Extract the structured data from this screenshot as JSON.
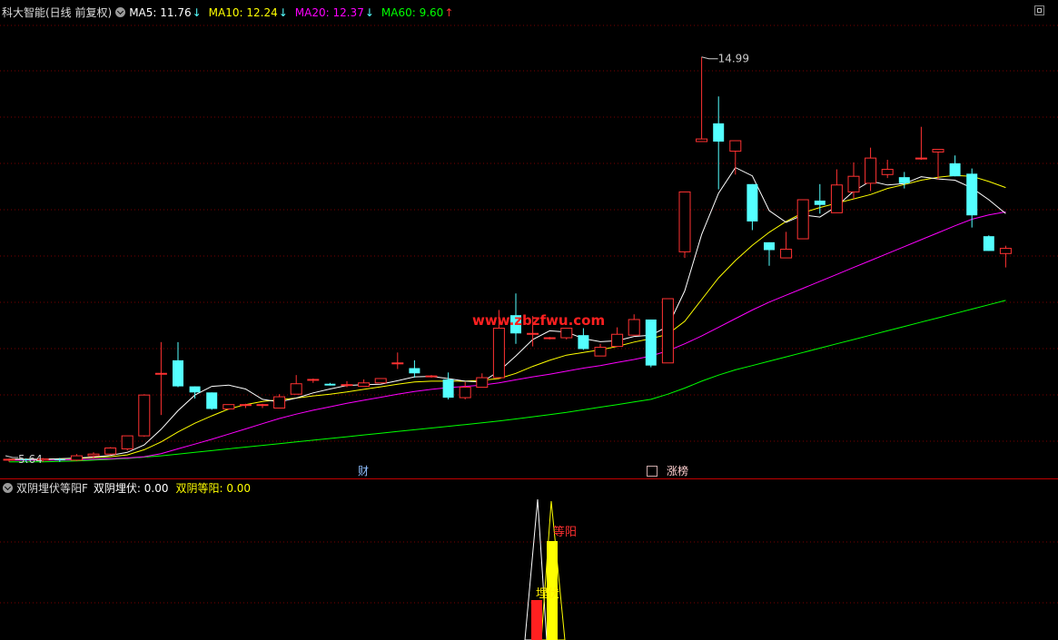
{
  "main_header": {
    "title": "科大智能(日线 前复权)",
    "ma5": {
      "label": "MA5: 11.76",
      "arrow": "↓",
      "color": "#ffffff"
    },
    "ma10": {
      "label": "MA10: 12.24",
      "arrow": "↓",
      "color": "#ffff00"
    },
    "ma20": {
      "label": "MA20: 12.37",
      "arrow": "↓",
      "color": "#ff00ff"
    },
    "ma60": {
      "label": "MA60: 9.60",
      "arrow": "↑",
      "color": "#00ff00"
    }
  },
  "chart_labels": {
    "high_price": "14.99",
    "low_price": "5.64",
    "watermark": "www.zbzfwu.com",
    "badge_finance": "财",
    "badge_limit": "涨榜"
  },
  "sub_header": {
    "indicator_name": "双阴埋伏等阳F",
    "line1": {
      "label": "双阴埋伏: 0.00",
      "color": "#ffffff"
    },
    "line2": {
      "label": "双阴等阳: 0.00",
      "color": "#ffff00"
    }
  },
  "sub_labels": {
    "deng_yang": "等阳",
    "mai_fu": "埋伏"
  },
  "colors": {
    "up": "#ff3232",
    "down": "#54ffff",
    "grid": "#7a0000",
    "divider": "#c00000"
  },
  "chart_data": {
    "type": "candlestick",
    "series": [
      {
        "name": "MA5",
        "color": "#ffffff"
      },
      {
        "name": "MA10",
        "color": "#ffff00"
      },
      {
        "name": "MA20",
        "color": "#ff00ff"
      },
      {
        "name": "MA60",
        "color": "#00ff00"
      }
    ],
    "candles": [
      [
        5.7,
        5.72,
        5.66,
        5.74
      ],
      [
        5.72,
        5.7,
        5.66,
        5.74
      ],
      [
        5.7,
        5.73,
        5.66,
        5.75
      ],
      [
        5.72,
        5.71,
        5.66,
        5.75
      ],
      [
        5.7,
        5.8,
        5.68,
        5.84
      ],
      [
        5.8,
        5.84,
        5.74,
        5.88
      ],
      [
        5.84,
        5.98,
        5.82,
        6.0
      ],
      [
        5.96,
        6.26,
        5.92,
        6.26
      ],
      [
        6.26,
        7.2,
        6.24,
        7.22
      ],
      [
        7.7,
        7.7,
        6.74,
        8.42
      ],
      [
        8.0,
        7.4,
        7.38,
        8.42
      ],
      [
        7.4,
        7.26,
        7.12,
        7.4
      ],
      [
        7.26,
        6.88,
        6.86,
        7.26
      ],
      [
        6.88,
        6.98,
        6.86,
        6.98
      ],
      [
        6.98,
        6.98,
        6.9,
        7.0
      ],
      [
        6.98,
        6.98,
        6.9,
        7.0
      ],
      [
        6.9,
        7.16,
        6.9,
        7.22
      ],
      [
        7.22,
        7.46,
        7.22,
        7.66
      ],
      [
        7.56,
        7.56,
        7.48,
        7.58
      ],
      [
        7.46,
        7.42,
        7.42,
        7.48
      ],
      [
        7.42,
        7.44,
        7.38,
        7.52
      ],
      [
        7.4,
        7.48,
        7.4,
        7.56
      ],
      [
        7.48,
        7.58,
        7.48,
        7.58
      ],
      [
        7.94,
        7.94,
        7.8,
        8.18
      ],
      [
        7.82,
        7.7,
        7.6,
        8.0
      ],
      [
        7.64,
        7.64,
        7.6,
        7.66
      ],
      [
        7.56,
        7.14,
        7.1,
        7.72
      ],
      [
        7.14,
        7.38,
        7.1,
        7.5
      ],
      [
        7.38,
        7.6,
        7.38,
        7.7
      ],
      [
        7.6,
        8.74,
        7.6,
        9.16
      ],
      [
        9.04,
        8.62,
        8.38,
        9.54
      ],
      [
        8.62,
        8.62,
        8.32,
        9.02
      ],
      [
        8.52,
        8.52,
        8.48,
        8.54
      ],
      [
        8.52,
        8.74,
        8.48,
        8.74
      ],
      [
        8.58,
        8.26,
        8.24,
        8.74
      ],
      [
        8.1,
        8.3,
        8.1,
        8.38
      ],
      [
        8.32,
        8.6,
        8.32,
        8.76
      ],
      [
        8.58,
        8.94,
        8.58,
        9.06
      ],
      [
        8.94,
        7.88,
        7.84,
        8.94
      ],
      [
        7.94,
        9.42,
        7.94,
        9.42
      ],
      [
        10.5,
        11.88,
        10.36,
        11.88
      ],
      [
        13.04,
        13.1,
        13.04,
        14.99
      ],
      [
        13.46,
        13.04,
        11.94,
        14.08
      ],
      [
        12.82,
        13.06,
        12.28,
        12.82
      ],
      [
        12.06,
        11.2,
        11.0,
        12.06
      ],
      [
        10.72,
        10.54,
        10.18,
        10.72
      ],
      [
        10.36,
        10.56,
        10.48,
        10.96
      ],
      [
        10.8,
        11.7,
        10.8,
        11.7
      ],
      [
        11.68,
        11.58,
        11.38,
        12.06
      ],
      [
        11.4,
        12.04,
        11.46,
        12.4
      ],
      [
        11.88,
        12.24,
        11.72,
        12.56
      ],
      [
        12.08,
        12.66,
        11.9,
        12.9
      ],
      [
        12.28,
        12.4,
        12.2,
        12.62
      ],
      [
        12.22,
        12.08,
        11.96,
        12.34
      ],
      [
        12.66,
        12.66,
        12.62,
        13.38
      ],
      [
        12.8,
        12.86,
        12.16,
        12.86
      ],
      [
        12.54,
        12.24,
        12.24,
        12.72
      ],
      [
        12.3,
        11.34,
        11.06,
        12.42
      ],
      [
        10.86,
        10.52,
        10.52,
        10.88
      ],
      [
        10.46,
        10.58,
        10.14,
        10.64
      ]
    ],
    "ma5": [
      5.72,
      5.72,
      5.72,
      5.73,
      5.75,
      5.77,
      5.81,
      5.88,
      6.05,
      6.41,
      6.84,
      7.2,
      7.4,
      7.43,
      7.34,
      7.1,
      7.04,
      7.13,
      7.25,
      7.34,
      7.42,
      7.44,
      7.45,
      7.53,
      7.62,
      7.63,
      7.58,
      7.52,
      7.5,
      7.75,
      8.1,
      8.48,
      8.68,
      8.65,
      8.5,
      8.43,
      8.45,
      8.55,
      8.58,
      8.78,
      9.6,
      10.9,
      11.85,
      12.44,
      12.25,
      11.45,
      11.18,
      11.35,
      11.3,
      11.55,
      11.9,
      12.13,
      12.04,
      12.07,
      12.23,
      12.18,
      12.15,
      11.97,
      11.7,
      11.38
    ],
    "ma10": [
      5.72,
      5.72,
      5.72,
      5.73,
      5.74,
      5.76,
      5.78,
      5.82,
      5.94,
      6.12,
      6.35,
      6.55,
      6.72,
      6.88,
      6.98,
      7.05,
      7.09,
      7.13,
      7.18,
      7.22,
      7.27,
      7.33,
      7.39,
      7.45,
      7.5,
      7.52,
      7.52,
      7.52,
      7.54,
      7.58,
      7.7,
      7.86,
      8.0,
      8.12,
      8.18,
      8.24,
      8.32,
      8.42,
      8.5,
      8.6,
      8.9,
      9.4,
      9.9,
      10.3,
      10.65,
      10.95,
      11.2,
      11.4,
      11.52,
      11.62,
      11.72,
      11.82,
      11.96,
      12.05,
      12.15,
      12.22,
      12.26,
      12.24,
      12.12,
      11.98
    ],
    "ma20": [
      5.7,
      5.7,
      5.7,
      5.7,
      5.71,
      5.72,
      5.73,
      5.75,
      5.78,
      5.85,
      5.96,
      6.07,
      6.18,
      6.3,
      6.42,
      6.54,
      6.66,
      6.76,
      6.85,
      6.93,
      7.01,
      7.08,
      7.15,
      7.22,
      7.28,
      7.33,
      7.37,
      7.4,
      7.43,
      7.48,
      7.55,
      7.62,
      7.68,
      7.75,
      7.82,
      7.88,
      7.95,
      8.02,
      8.1,
      8.22,
      8.38,
      8.56,
      8.76,
      8.96,
      9.16,
      9.34,
      9.5,
      9.66,
      9.82,
      9.98,
      10.14,
      10.3,
      10.46,
      10.62,
      10.78,
      10.94,
      11.1,
      11.25,
      11.35,
      11.42
    ],
    "ma60": [
      5.66,
      5.66,
      5.66,
      5.67,
      5.68,
      5.7,
      5.72,
      5.74,
      5.77,
      5.8,
      5.84,
      5.88,
      5.92,
      5.96,
      6.0,
      6.04,
      6.08,
      6.12,
      6.16,
      6.2,
      6.24,
      6.28,
      6.32,
      6.36,
      6.4,
      6.44,
      6.48,
      6.52,
      6.56,
      6.6,
      6.65,
      6.7,
      6.75,
      6.8,
      6.86,
      6.92,
      6.98,
      7.04,
      7.1,
      7.22,
      7.36,
      7.52,
      7.66,
      7.78,
      7.88,
      7.98,
      8.08,
      8.18,
      8.28,
      8.38,
      8.48,
      8.58,
      8.68,
      8.78,
      8.88,
      8.98,
      9.08,
      9.18,
      9.28,
      9.38
    ],
    "y_range": [
      5.3,
      15.8
    ],
    "grid": true,
    "high_annotation": 14.99,
    "low_annotation": 5.64
  }
}
